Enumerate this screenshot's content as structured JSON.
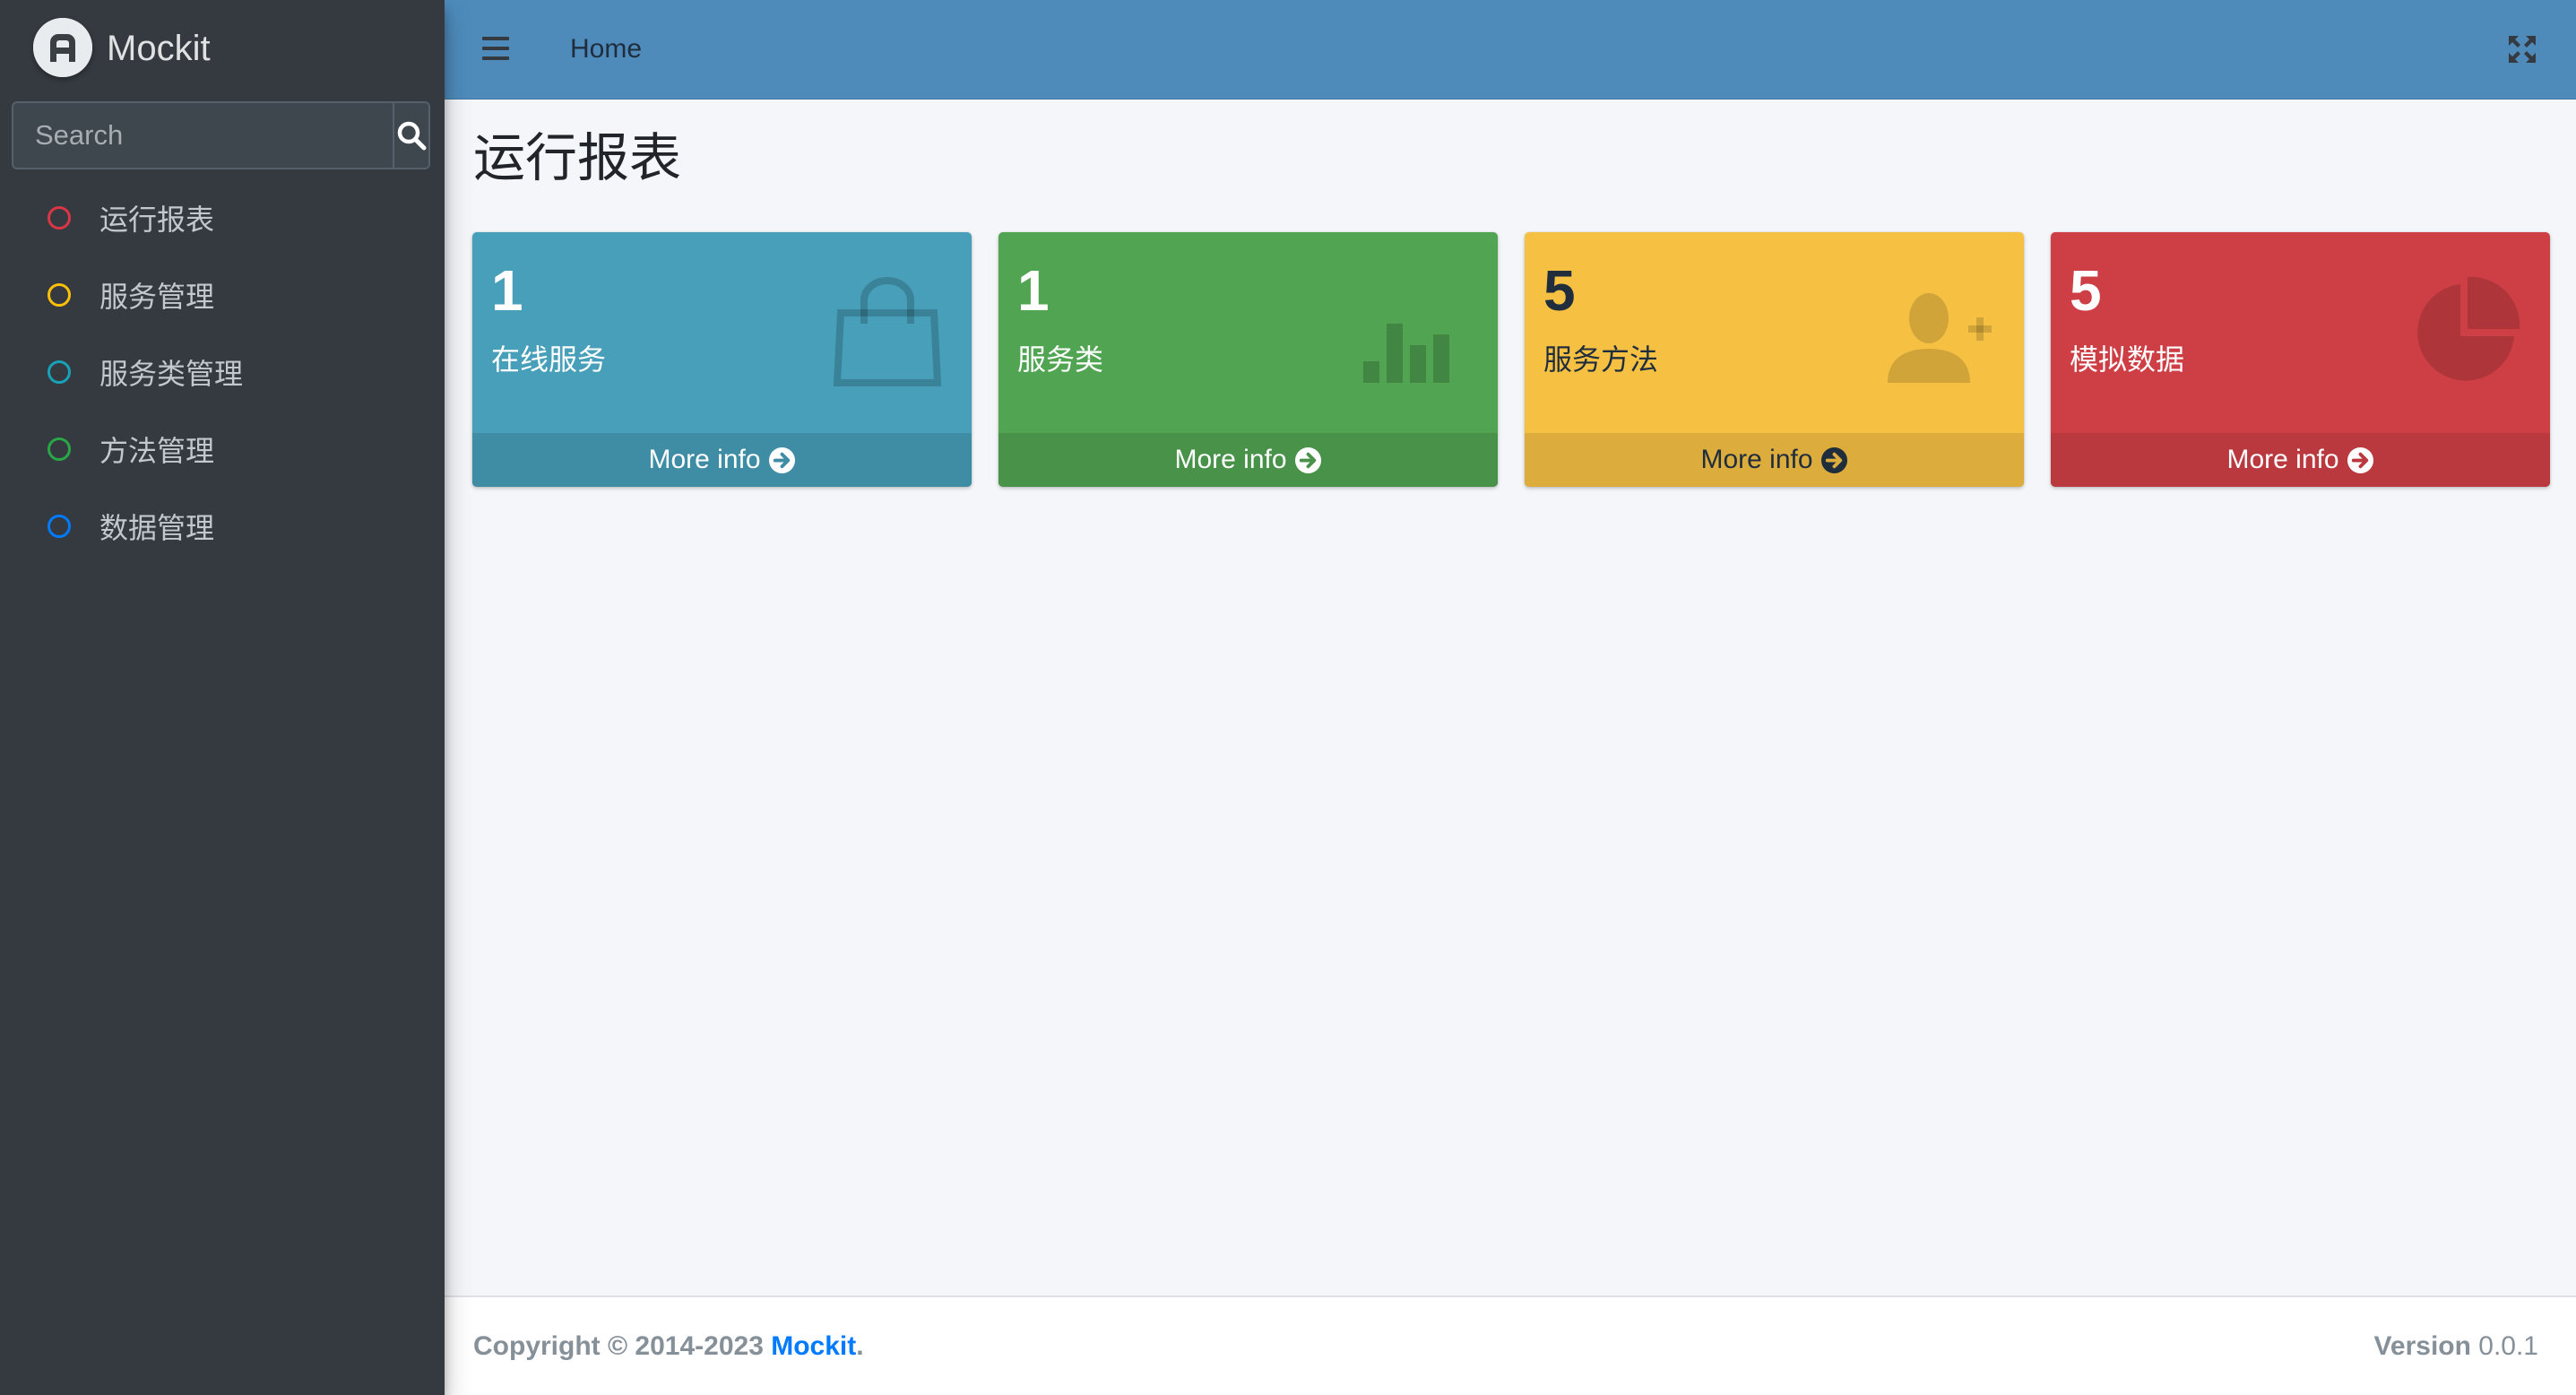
{
  "brand": {
    "name": "Mockit"
  },
  "sidebar": {
    "search": {
      "placeholder": "Search",
      "value": ""
    },
    "items": [
      {
        "label": "运行报表",
        "color": "#dc3545"
      },
      {
        "label": "服务管理",
        "color": "#ffc107"
      },
      {
        "label": "服务类管理",
        "color": "#17a2b8"
      },
      {
        "label": "方法管理",
        "color": "#28a745"
      },
      {
        "label": "数据管理",
        "color": "#007bff"
      }
    ]
  },
  "header": {
    "home_label": "Home"
  },
  "main": {
    "title": "运行报表",
    "boxes": [
      {
        "number": "1",
        "label": "在线服务",
        "more": "More info",
        "bg": "#479fb9",
        "footer_bg": "#3f8da5",
        "icon": "shopping-bag-icon"
      },
      {
        "number": "1",
        "label": "服务类",
        "more": "More info",
        "bg": "#51a452",
        "footer_bg": "#489249",
        "icon": "bar-chart-icon"
      },
      {
        "number": "5",
        "label": "服务方法",
        "more": "More info",
        "bg": "#f6c143",
        "footer_bg": "#dcac3c",
        "icon": "user-plus-icon"
      },
      {
        "number": "5",
        "label": "模拟数据",
        "more": "More info",
        "bg": "#cd3f45",
        "footer_bg": "#b9393e",
        "icon": "pie-chart-icon"
      }
    ]
  },
  "footer": {
    "copyright": "Copyright © 2014-2023 ",
    "link": "Mockit",
    "period": ".",
    "version_label": "Version",
    "version_value": " 0.0.1"
  }
}
